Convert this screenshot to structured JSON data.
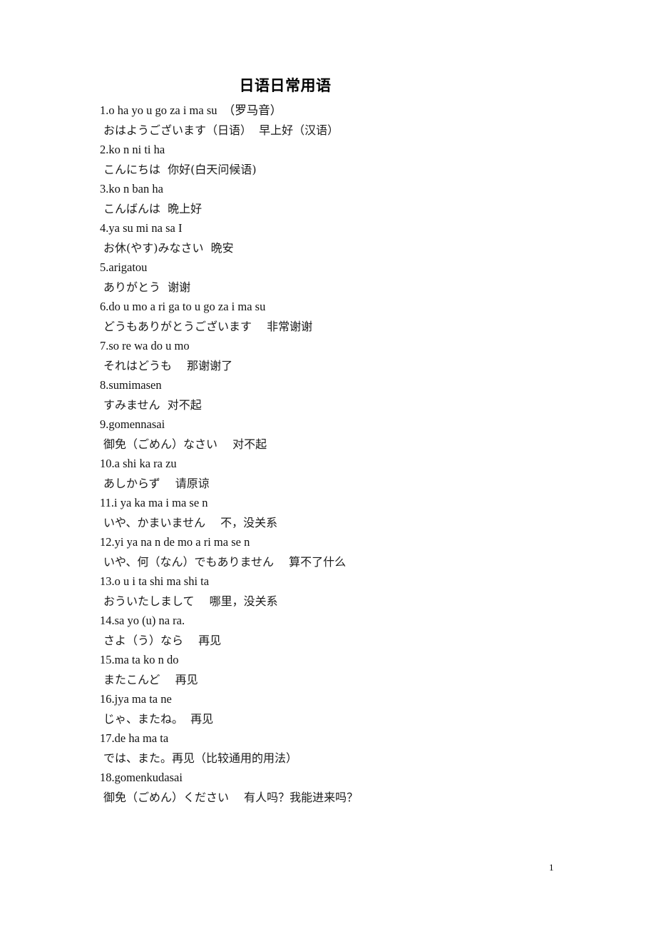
{
  "document": {
    "title": "日语日常用语",
    "page_number": "1"
  },
  "entries": [
    {
      "romaji": "1.o ha yo u go za i ma su  （罗马音）",
      "translation": "おはようございます（日语）  早上好（汉语）"
    },
    {
      "romaji": "2.ko n ni ti ha",
      "translation": "こんにちは  你好(白天问候语)"
    },
    {
      "romaji": "3.ko n ban ha",
      "translation": "こんばんは  晩上好"
    },
    {
      "romaji": "4.ya su mi na sa I",
      "translation": "お休(やす)みなさい  晩安"
    },
    {
      "romaji": "5.arigatou",
      "translation": "ありがとう  谢谢"
    },
    {
      "romaji": "6.do u mo a ri ga to u go za i ma su",
      "translation": "どうもありがとうございます　 非常谢谢"
    },
    {
      "romaji": "7.so re wa do u mo",
      "translation": "それはどうも　 那谢谢了"
    },
    {
      "romaji": "8.sumimasen",
      "translation": "すみません  对不起"
    },
    {
      "romaji": "9.gomennasai",
      "translation": "御免（ごめん）なさい　 对不起"
    },
    {
      "romaji": "10.a shi ka ra zu",
      "translation": "あしからず　 请原谅"
    },
    {
      "romaji": "11.i ya ka ma i ma se n",
      "translation": "いや、かまいません　 不，没关系"
    },
    {
      "romaji": "12.yi ya na n de mo a ri ma se n",
      "translation": "いや、何（なん）でもありません　 算不了什么"
    },
    {
      "romaji": "13.o u i ta shi ma shi ta",
      "translation": "おういたしまして　 哪里，没关系"
    },
    {
      "romaji": "14.sa yo (u) na ra.",
      "translation": "さよ（う）なら　 再见"
    },
    {
      "romaji": "15.ma ta ko n do",
      "translation": "またこんど　 再见"
    },
    {
      "romaji": "16.jya ma ta ne",
      "translation": "じゃ、またね。  再见"
    },
    {
      "romaji": "17.de ha ma ta",
      "translation": "では、また。再见（比较通用的用法）"
    },
    {
      "romaji": "18.gomenkudasai",
      "translation": "御免（ごめん）ください　 有人吗？我能进来吗？"
    }
  ]
}
